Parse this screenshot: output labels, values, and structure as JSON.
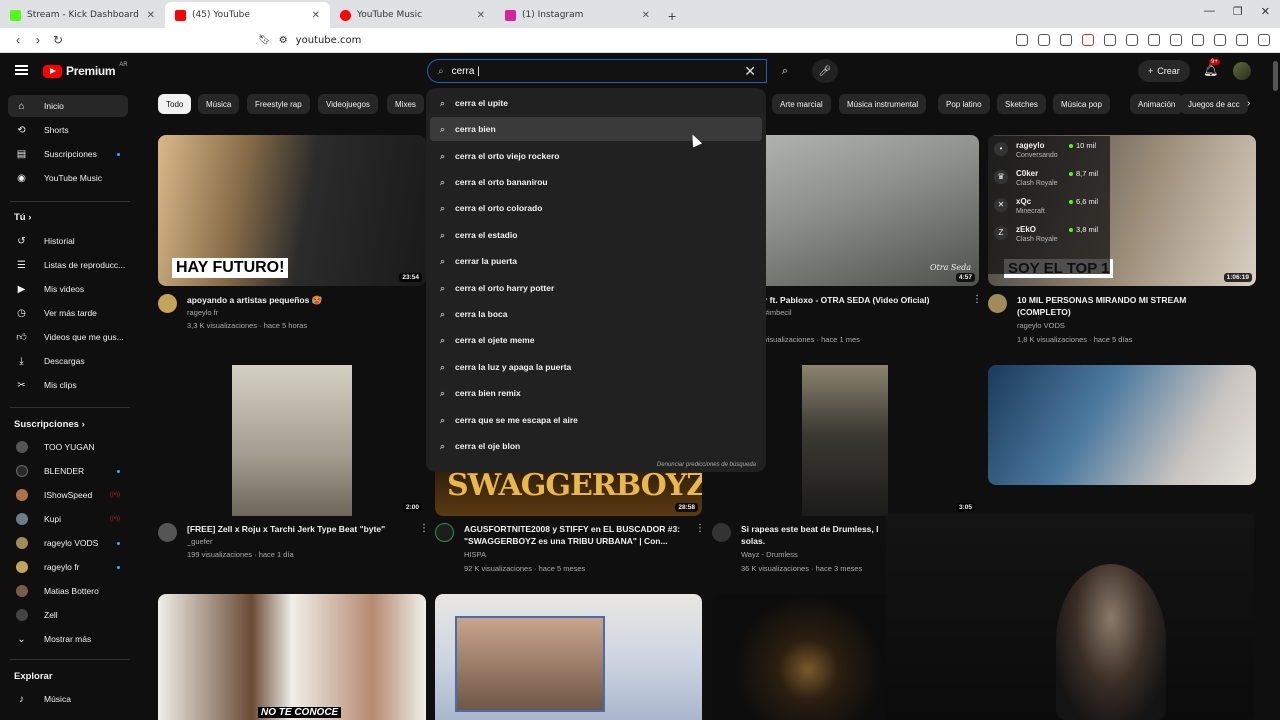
{
  "browser": {
    "tabs": [
      {
        "label": "Stream - Kick Dashboard",
        "favicon_color": "#53fc18",
        "active": false
      },
      {
        "label": "(45) YouTube",
        "favicon_color": "#ff0000",
        "active": true
      },
      {
        "label": "YouTube Music",
        "favicon_color": "#ff0000",
        "active": false
      },
      {
        "label": "(1) Instagram",
        "favicon_color": "#d6249f",
        "active": false
      }
    ],
    "url": "youtube.com"
  },
  "header": {
    "logo_word": "Premium",
    "country_code": "AR",
    "search_value": "cerra |",
    "create_label": "Crear",
    "notif_badge": "9+"
  },
  "sidebar": {
    "main": [
      {
        "label": "Inicio",
        "icon": "home-icon"
      },
      {
        "label": "Shorts",
        "icon": "shorts-icon"
      },
      {
        "label": "Suscripciones",
        "icon": "subscriptions-icon"
      },
      {
        "label": "YouTube Music",
        "icon": "music-icon"
      }
    ],
    "you_title": "Tú",
    "you": [
      {
        "label": "Historial",
        "icon": "history-icon"
      },
      {
        "label": "Listas de reproducc...",
        "icon": "playlist-icon"
      },
      {
        "label": "Mis videos",
        "icon": "my-videos-icon"
      },
      {
        "label": "Ver más tarde",
        "icon": "watch-later-icon"
      },
      {
        "label": "Videos que me gus...",
        "icon": "like-icon"
      },
      {
        "label": "Descargas",
        "icon": "download-icon"
      },
      {
        "label": "Mis clips",
        "icon": "clips-icon"
      }
    ],
    "subs_title": "Suscripciones",
    "subs": [
      {
        "label": "TOO YUGAN",
        "color": "#555"
      },
      {
        "label": "BLENDER",
        "color": "#2a2a2a"
      },
      {
        "label": "IShowSpeed",
        "color": "#b0704b"
      },
      {
        "label": "Kupi",
        "color": "#6a7c87"
      },
      {
        "label": "rageylo VODS",
        "color": "#a08b5a"
      },
      {
        "label": "rageylo fr",
        "color": "#c4a35a"
      },
      {
        "label": "Matias Bottero",
        "color": "#7a5a48"
      },
      {
        "label": "Zell",
        "color": "#444"
      }
    ],
    "show_more": "Mostrar más",
    "explore_title": "Explorar",
    "explore": [
      {
        "label": "Música",
        "icon": "music-note-icon"
      }
    ]
  },
  "chips": [
    "Todo",
    "Música",
    "Freestyle rap",
    "Videojuegos",
    "Mixes",
    "Arte marcial",
    "Música instrumental",
    "Pop latino",
    "Sketches",
    "Música pop",
    "Animación",
    "Juegos de acc"
  ],
  "suggestions": [
    "cerra el upite",
    "cerra bien",
    "cerra el orto viejo rockero",
    "cerra el orto bananirou",
    "cerra el orto colorado",
    "cerra el estadio",
    "cerrar la puerta",
    "cerra el orto harry potter",
    "cerra la boca",
    "cerra el ojete meme",
    "cerra la luz y apaga la puerta",
    "cerra bien remix",
    "cerra que se me escapa el aire",
    "cerra el oje blon"
  ],
  "report_label": "Denunciar predicciones de búsqueda",
  "videos": [
    {
      "title": "apoyando a artistas pequeños 🥵",
      "channel": "rageylo fr",
      "stats": "3,3 K visualizaciones · hace 5 horas",
      "duration": "23:54",
      "overlay": "HAY FUTURO!"
    },
    {
      "title": "r ft. Pabloxo - OTRA SEDA (Video Oficial)",
      "channel": "#imbecil",
      "stats": "visualizaciones · hace 1 mes",
      "duration": "4:57"
    },
    {
      "title": "10 MIL PERSONAS MIRANDO MI STREAM (COMPLETO)",
      "channel": "rageylo VODS",
      "stats": "1,8 K visualizaciones · hace 5 días",
      "duration": "1:06:19",
      "overlay": "SOY EL TOP 1"
    },
    {
      "title": "[FREE] Zell x Roju x Tarchi Jerk Type Beat \"byte\"",
      "channel": "_guefer",
      "stats": "199 visualizaciones · hace 1 día",
      "duration": "2:00"
    },
    {
      "title": "AGUSFORTNITE2008 y STIFFY en EL BUSCADOR #3: \"SWAGGERBOYZ es una TRIBU URBANA\" | Con...",
      "channel": "HISPA",
      "stats": "92 K visualizaciones · hace 5 meses",
      "duration": "28:58",
      "overlay": "SWAGGERBOYZ"
    },
    {
      "title": "Si rapeas este beat de Drumless, l solas.",
      "channel": "Wayz - Drumless",
      "stats": "36 K visualizaciones · hace 3 meses",
      "duration": "3:05"
    }
  ],
  "third_row_overlay": "NO TE CONOCE",
  "live_widget": [
    {
      "name": "rageylo",
      "sub": "Conversando",
      "count": "10 mil"
    },
    {
      "name": "C0ker",
      "sub": "Clash Royale",
      "count": "8,7 mil"
    },
    {
      "name": "xQc",
      "sub": "Minecraft",
      "count": "6,6 mil"
    },
    {
      "name": "zEkO",
      "sub": "Clash Royale",
      "count": "3,8 mil"
    }
  ],
  "watermark": "Otra Seda"
}
